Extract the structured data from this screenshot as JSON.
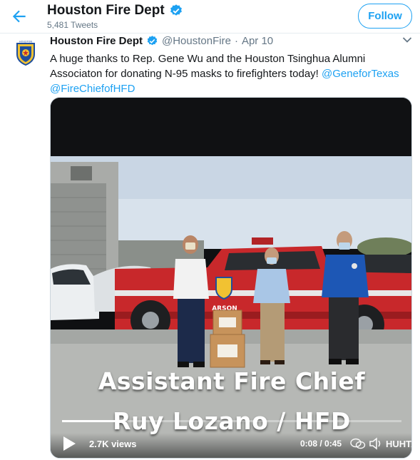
{
  "header": {
    "name": "Houston Fire Dept",
    "tweet_count": "5,481 Tweets",
    "follow_label": "Follow"
  },
  "tweet": {
    "name": "Houston Fire Dept",
    "handle": "@HoustonFire",
    "separator": "·",
    "date": "Apr 10",
    "text_main": "A huge thanks to Rep. Gene Wu and the Houston Tsinghua Alumni Associaton for donating N-95 masks to firefighters today! ",
    "mention_1": "@GeneforTexas",
    "mention_2": "@FireChiefofHFD",
    "avatar_label": "HOUSTON"
  },
  "video": {
    "caption_line1": "Assistant Fire Chief",
    "caption_line2": "Ruy Lozano / HFD",
    "views": "2.7K views",
    "time": "0:08 / 0:45",
    "progress": 0.18,
    "watermark": "HUHTAA",
    "truck_label": "ARSON"
  },
  "colors": {
    "accent": "#1da1f2",
    "verified": "#1da1f2",
    "truck_red": "#c8282b"
  }
}
